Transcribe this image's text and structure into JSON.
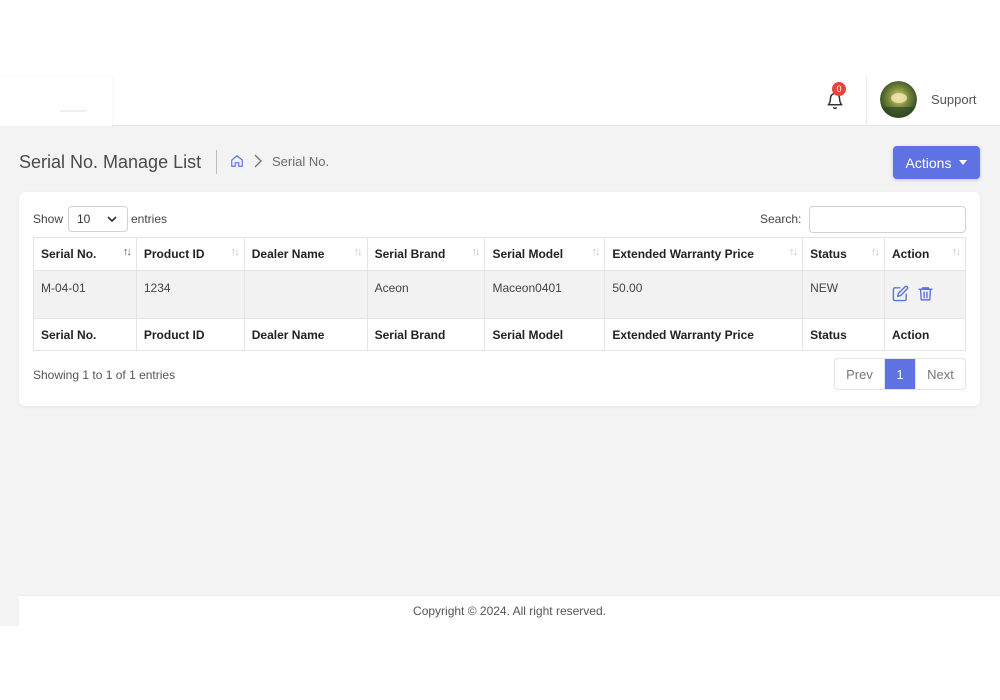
{
  "header": {
    "notification_count": "0",
    "user_name": "Support",
    "icons": {
      "bell": "bell-icon",
      "avatar": "user-avatar"
    }
  },
  "page": {
    "title": "Serial No. Manage List",
    "breadcrumb": {
      "home_icon": "home-icon",
      "current": "Serial No."
    },
    "actions_label": "Actions"
  },
  "table_controls": {
    "show_label": "Show",
    "page_length": "10",
    "entries_label": "entries",
    "search_label": "Search:",
    "search_value": ""
  },
  "table": {
    "columns": [
      "Serial No.",
      "Product ID",
      "Dealer Name",
      "Serial Brand",
      "Serial Model",
      "Extended Warranty Price",
      "Status",
      "Action"
    ],
    "rows": [
      {
        "serial_no": "M-04-01",
        "product_id": "1234",
        "dealer_name": "",
        "serial_brand": "Aceon",
        "serial_model": "Maceon0401",
        "warranty_price": "50.00",
        "status": "NEW",
        "action_icons": [
          "edit-icon",
          "trash-icon"
        ]
      }
    ],
    "footer_columns": [
      "Serial No.",
      "Product ID",
      "Dealer Name",
      "Serial Brand",
      "Serial Model",
      "Extended Warranty Price",
      "Status",
      "Action"
    ]
  },
  "pagination": {
    "info": "Showing 1 to 1 of 1 entries",
    "prev": "Prev",
    "current": "1",
    "next": "Next"
  },
  "footer": {
    "copyright": "Copyright © 2024. All right reserved."
  },
  "colors": {
    "primary": "#5e72e4",
    "badge": "#e8443b",
    "background": "#f3f3f4"
  }
}
